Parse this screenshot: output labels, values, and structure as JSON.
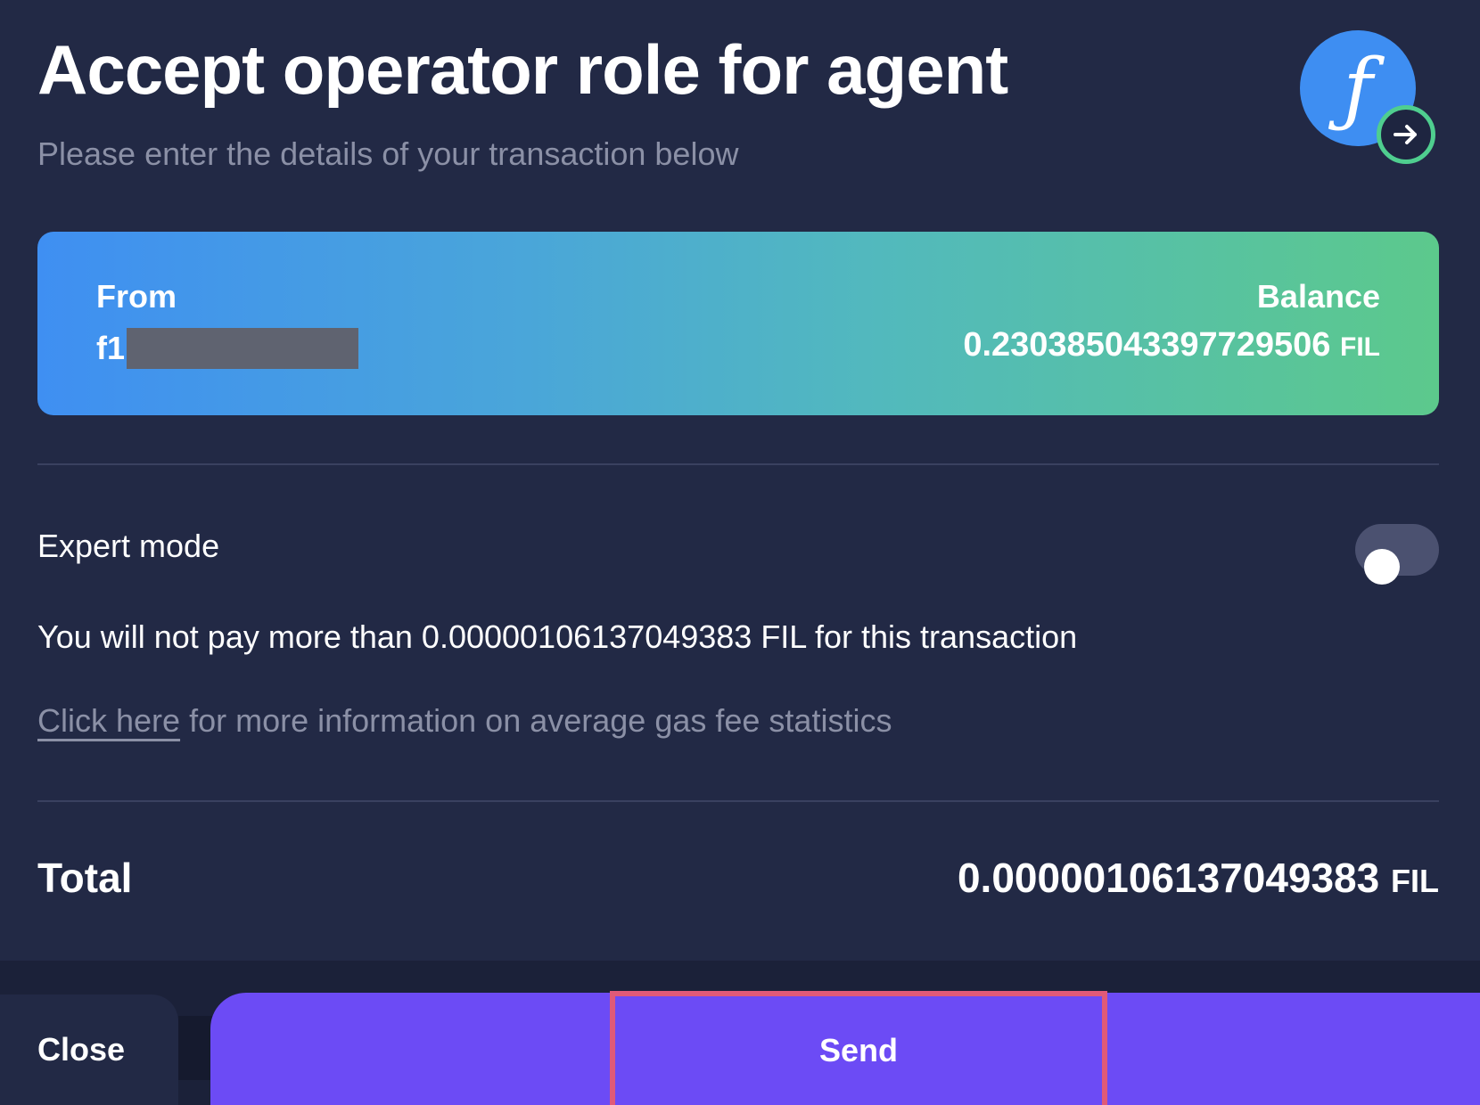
{
  "header": {
    "title": "Accept operator role for agent",
    "subtitle": "Please enter the details of your transaction below",
    "logo_icon": "filecoin-logo-icon",
    "logo_badge_icon": "arrow-right-icon"
  },
  "from_card": {
    "from_label": "From",
    "address_prefix": "f1",
    "balance_label": "Balance",
    "balance_value": "0.230385043397729506",
    "balance_unit": "FIL"
  },
  "expert_mode": {
    "label": "Expert mode",
    "enabled": false
  },
  "fee": {
    "max_pay_text": "You will not pay more than 0.00000106137049383 FIL for this transaction",
    "gas_link_text": "Click here",
    "gas_info_text": " for more information on average gas fee statistics"
  },
  "total": {
    "label": "Total",
    "value": "0.00000106137049383",
    "unit": "FIL"
  },
  "footer": {
    "close_label": "Close",
    "send_label": "Send"
  },
  "colors": {
    "background": "#222945",
    "accent": "#6c4bf5",
    "card_gradient_start": "#3f8ff2",
    "card_gradient_end": "#5cc98c",
    "highlight": "#e05a78"
  }
}
